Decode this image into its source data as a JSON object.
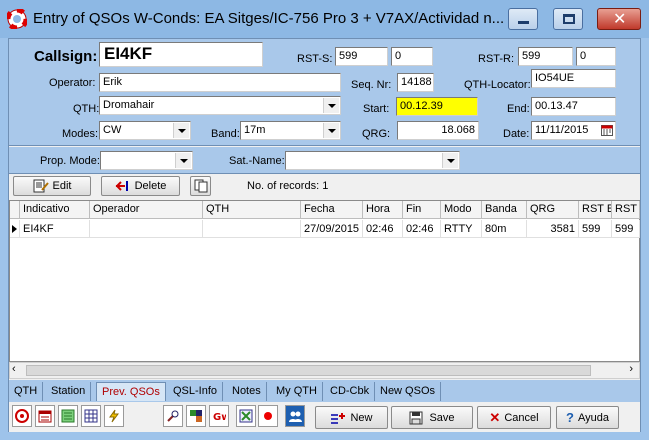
{
  "window": {
    "title": "Entry of QSOs   W-Conds: EA Sitges/IC-756 Pro 3 + V7AX/Actividad n..."
  },
  "form": {
    "callsign_label": "Callsign:",
    "callsign": "EI4KF",
    "rst_s_label": "RST-S:",
    "rst_s": "599",
    "rst_s2": "0",
    "rst_r_label": "RST-R:",
    "rst_r": "599",
    "rst_r2": "0",
    "operator_label": "Operator:",
    "operator": "Erik",
    "seq_label": "Seq. Nr:",
    "seq": "14188",
    "locator_label": "QTH-Locator:",
    "locator": "IO54UE",
    "qth_label": "QTH:",
    "qth": "Dromahair",
    "start_label": "Start:",
    "start": "00.12.39",
    "end_label": "End:",
    "end": "00.13.47",
    "modes_label": "Modes:",
    "mode": "CW",
    "band_label": "Band:",
    "band": "17m",
    "qrg_label": "QRG:",
    "qrg": "18.068",
    "date_label": "Date:",
    "date": "11/11/2015",
    "prop_label": "Prop. Mode:",
    "prop": "",
    "sat_label": "Sat.-Name:",
    "sat": ""
  },
  "toolbar": {
    "edit": "Edit",
    "delete": "Delete",
    "records": "No. of records: 1"
  },
  "table": {
    "headers": [
      "Indicativo",
      "Operador",
      "QTH",
      "Fecha",
      "Hora",
      "Fin",
      "Modo",
      "Banda",
      "QRG",
      "RST E",
      "RST"
    ],
    "rows": [
      [
        "EI4KF",
        "",
        "",
        "27/09/2015",
        "02:46",
        "02:46",
        "RTTY",
        "80m",
        "3581",
        "599",
        "599"
      ]
    ]
  },
  "tabs": [
    "QTH",
    "Station",
    "Prev. QSOs",
    "QSL-Info",
    "Notes",
    "My QTH",
    "CD-Cbk",
    "New QSOs"
  ],
  "buttons": {
    "new": "New",
    "save": "Save",
    "cancel": "Cancel",
    "help": "Ayuda"
  }
}
